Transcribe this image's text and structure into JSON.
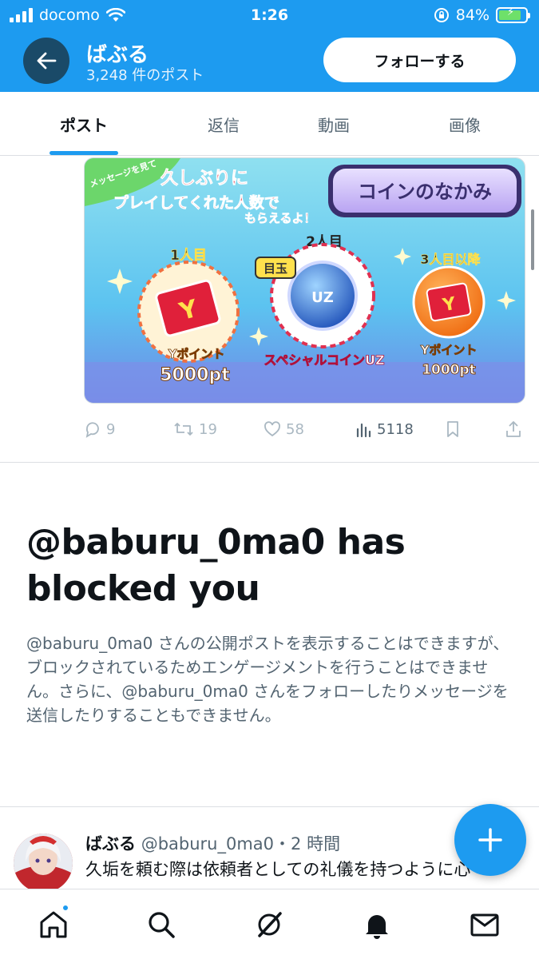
{
  "status_bar": {
    "carrier": "docomo",
    "time": "1:26",
    "battery": "84%",
    "battery_level": 0.84
  },
  "header": {
    "profile_name": "ばぶる",
    "post_count": "3,248 件のポスト",
    "follow_label": "フォローする"
  },
  "tabs": [
    {
      "label": "ポスト",
      "active": true
    },
    {
      "label": "返信",
      "active": false
    },
    {
      "label": "動画",
      "active": false
    },
    {
      "label": "画像",
      "active": false
    }
  ],
  "post_image": {
    "badge": "メッセージを見て",
    "headline_1": "久しぶりに",
    "headline_2": "プレイしてくれた人数で",
    "headline_3": "もらえるよ！",
    "coin_button": "コインのなかみ",
    "rewards": [
      {
        "rank": "1人目",
        "item": "Yポイント",
        "amount": "5000pt"
      },
      {
        "rank": "2人目",
        "tag": "目玉",
        "item": "スペシャルコインUZ"
      },
      {
        "rank": "3人目以降",
        "item": "Yポイント",
        "amount": "1000pt"
      }
    ]
  },
  "post_actions": {
    "replies": "9",
    "reposts": "19",
    "likes": "58",
    "views": "5118"
  },
  "blocked": {
    "title": "@baburu_0ma0 has blocked you",
    "description": "@baburu_0ma0 さんの公開ポストを表示することはできますが、ブロックされているためエンゲージメントを行うことはできません。さらに、@baburu_0ma0 さんをフォローしたりメッセージを送信したりすることもできません。"
  },
  "next_post": {
    "name": "ばぶる",
    "handle": "@baburu_0ma0",
    "time": "・2 時間",
    "text": "久垢を頼む際は依頼者としての礼儀を持つように心"
  },
  "fab": {
    "icon": "plus-icon"
  },
  "bottom_nav": [
    "home-icon",
    "search-icon",
    "grok-icon",
    "notifications-icon",
    "messages-icon"
  ],
  "colors": {
    "accent": "#1d9bf0",
    "header_dark": "#1a4a68",
    "text_primary": "#0f1419",
    "text_secondary": "#536471"
  }
}
